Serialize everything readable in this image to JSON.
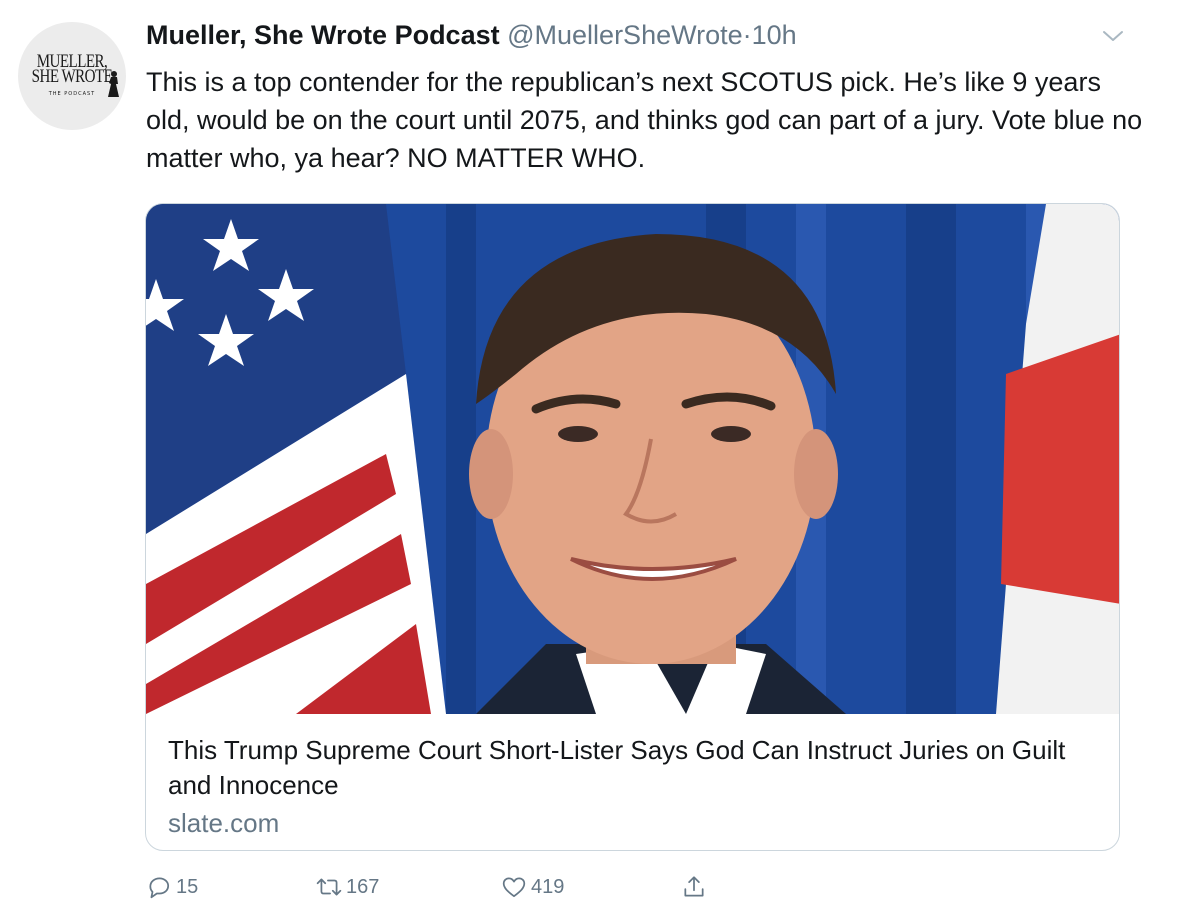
{
  "author": {
    "display_name": "Mueller, She Wrote Podcast",
    "handle": "@MuellerSheWrote",
    "separator": "·",
    "time": "10h",
    "avatar_icon": "mueller-she-wrote-logo",
    "avatar_logo_lines": [
      "MUELLER,",
      "SHE WROTE",
      "THE PODCAST"
    ]
  },
  "tweet_text": "This is a top contender for the republican’s next SCOTUS pick. He’s like 9 years old, would be on the court until 2075, and thinks god can part of a jury. Vote blue no matter who, ya hear? NO MATTER WHO.",
  "card": {
    "image_icon": "portrait-photo",
    "title": "This Trump Supreme Court Short-Lister Says God Can Instruct Juries on Guilt and Innocence",
    "domain": "slate.com"
  },
  "actions": {
    "reply_count": "15",
    "retweet_count": "167",
    "like_count": "419",
    "reply_icon": "reply-icon",
    "retweet_icon": "retweet-icon",
    "like_icon": "heart-icon",
    "share_icon": "share-icon"
  },
  "colors": {
    "text": "#14171a",
    "secondary": "#657786",
    "border": "#ccd6dd"
  }
}
